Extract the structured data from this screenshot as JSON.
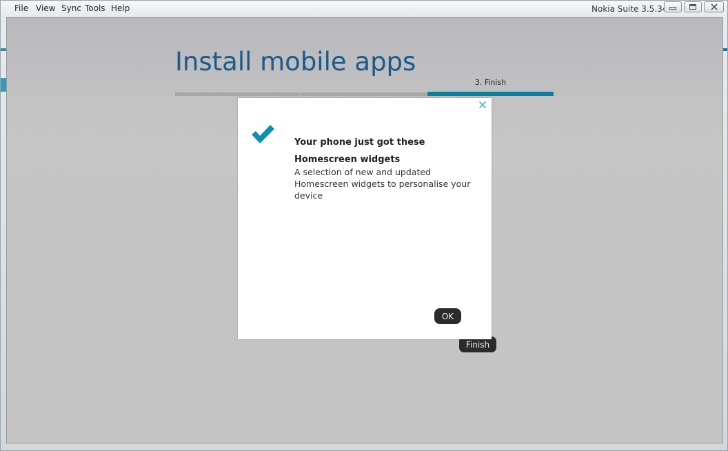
{
  "menu": {
    "file": "File",
    "view": "View",
    "sync": "Sync",
    "tools": "Tools",
    "help": "Help"
  },
  "window": {
    "title": "Nokia Suite 3.5.34",
    "icons": [
      "minimize-icon",
      "maximize-icon",
      "close-icon"
    ]
  },
  "page": {
    "title": "Install mobile apps",
    "steps": [
      {
        "label": "",
        "state": "done"
      },
      {
        "label": "",
        "state": "done"
      },
      {
        "label": "3. Finish",
        "state": "active"
      }
    ],
    "finish_label": "Finish"
  },
  "dialog": {
    "heading": "Your phone just got these",
    "item_title": "Homescreen widgets",
    "item_description": "A selection of new and updated Homescreen widgets to personalise your device",
    "ok_label": "OK",
    "icons": [
      "checkmark-icon",
      "close-icon"
    ]
  },
  "colors": {
    "accent": "#0e7ea0",
    "title_blue": "#1a5a8c",
    "step_done": "#a8a8a8",
    "dark_button": "#2b2b2b",
    "close_icon": "#4ab6d0"
  }
}
